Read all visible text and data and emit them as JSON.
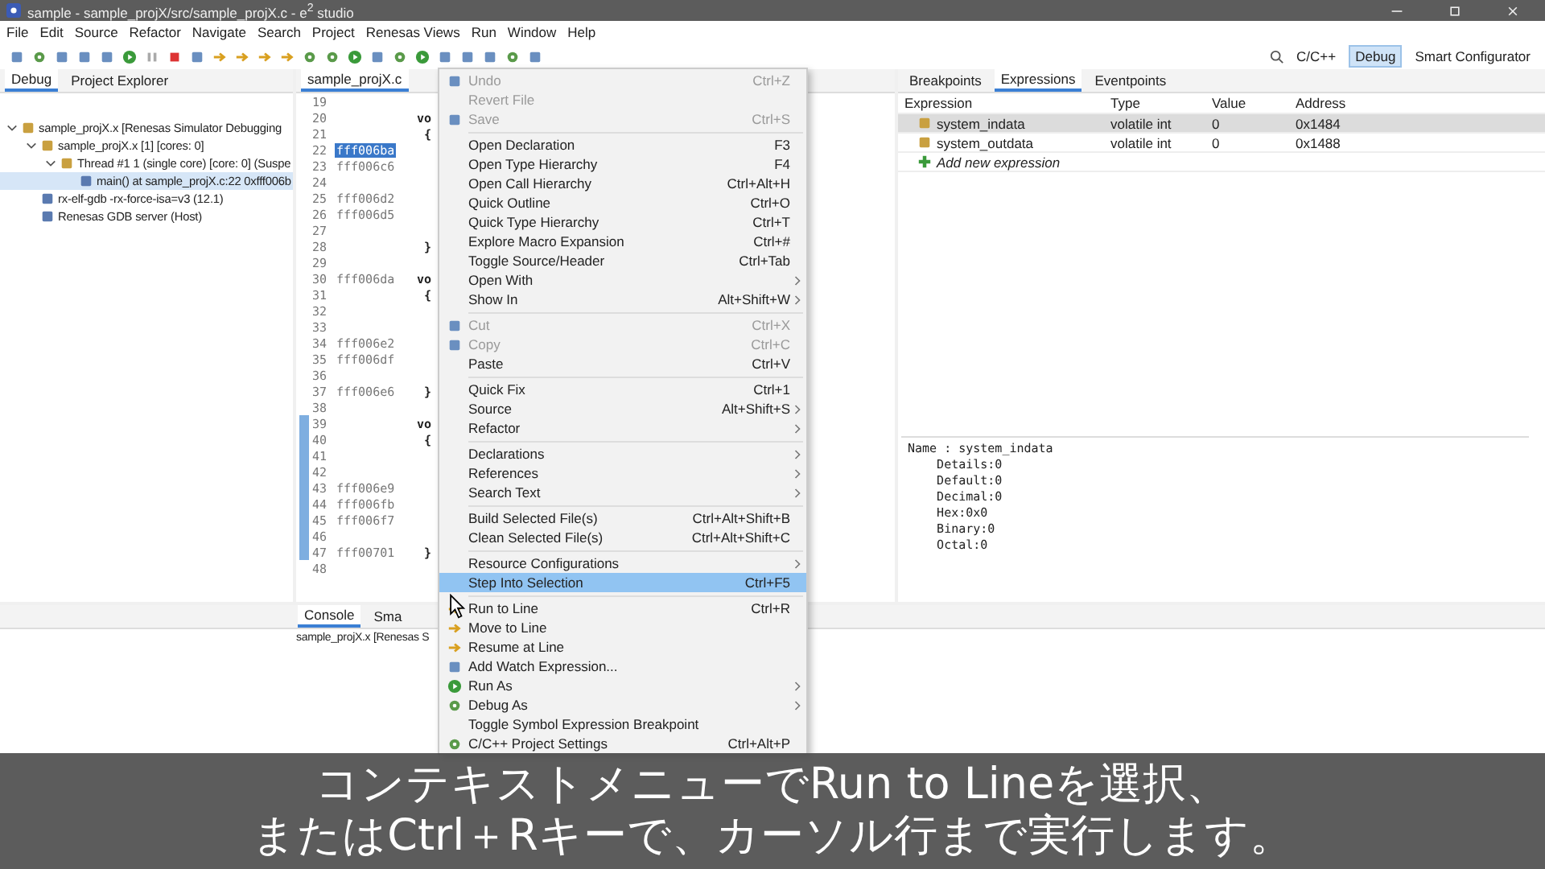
{
  "window": {
    "title": "sample - sample_projX/src/sample_projX.c - e$^{2}$ studio"
  },
  "menu_bar": [
    "File",
    "Edit",
    "Source",
    "Refactor",
    "Navigate",
    "Search",
    "Project",
    "Renesas Views",
    "Run",
    "Window",
    "Help"
  ],
  "perspectives": [
    {
      "label": "C/C++",
      "selected": false
    },
    {
      "label": "Debug",
      "selected": true
    },
    {
      "label": "Smart Configurator",
      "selected": false
    }
  ],
  "debug_panel": {
    "tabs": [
      {
        "label": "Debug",
        "selected": true
      },
      {
        "label": "Project Explorer",
        "selected": false
      }
    ],
    "tree": [
      {
        "label": "sample_projX.x [Renesas Simulator Debugging",
        "expanded": true,
        "selected": false,
        "children": [
          {
            "label": "sample_projX.x [1] [cores: 0]",
            "expanded": true,
            "selected": false,
            "children": [
              {
                "label": "Thread #1 1 (single core) [core: 0] (Suspe",
                "expanded": true,
                "selected": false,
                "children": [
                  {
                    "label": "main() at sample_projX.c:22 0xfff006b",
                    "selected": true
                  }
                ]
              }
            ]
          },
          {
            "label": "rx-elf-gdb -rx-force-isa=v3 (12.1)",
            "selected": false
          },
          {
            "label": "Renesas GDB server (Host)",
            "selected": false
          }
        ]
      }
    ]
  },
  "editor": {
    "tab": "sample_projX.c",
    "lines": [
      {
        "number": "19",
        "marked": false
      },
      {
        "number": "20",
        "code": "vo",
        "marked": false
      },
      {
        "number": "21",
        "code": "{",
        "marked": false
      },
      {
        "number": "22",
        "address": "fff006ba",
        "marked": false,
        "current": true
      },
      {
        "number": "23",
        "address": "fff006c6",
        "marked": false
      },
      {
        "number": "24",
        "marked": false
      },
      {
        "number": "25",
        "address": "fff006d2",
        "marked": false
      },
      {
        "number": "26",
        "address": "fff006d5",
        "marked": false
      },
      {
        "number": "27",
        "marked": false
      },
      {
        "number": "28",
        "code": "}",
        "marked": false
      },
      {
        "number": "29",
        "marked": false
      },
      {
        "number": "30",
        "address": "fff006da",
        "code": "vo",
        "marked": false
      },
      {
        "number": "31",
        "code": "{",
        "marked": false
      },
      {
        "number": "32",
        "marked": false
      },
      {
        "number": "33",
        "marked": false
      },
      {
        "number": "34",
        "address": "fff006e2",
        "marked": false
      },
      {
        "number": "35",
        "address": "fff006df",
        "marked": false
      },
      {
        "number": "36",
        "marked": false
      },
      {
        "number": "37",
        "address": "fff006e6",
        "code": "}",
        "marked": false
      },
      {
        "number": "38",
        "marked": false
      },
      {
        "number": "39",
        "code": "vo",
        "marked": true
      },
      {
        "number": "40",
        "code": "{",
        "marked": true
      },
      {
        "number": "41",
        "marked": true
      },
      {
        "number": "42",
        "marked": true
      },
      {
        "number": "43",
        "address": "fff006e9",
        "marked": true
      },
      {
        "number": "44",
        "address": "fff006fb",
        "marked": true
      },
      {
        "number": "45",
        "address": "fff006f7",
        "marked": true
      },
      {
        "number": "46",
        "marked": true
      },
      {
        "number": "47",
        "address": "fff00701",
        "code": "}",
        "marked": true
      },
      {
        "number": "48",
        "marked": false
      }
    ]
  },
  "context_menu": [
    {
      "kind": "item",
      "label": "Undo",
      "shortcut": "Ctrl+Z",
      "disabled": true,
      "submenu": false,
      "selected": false
    },
    {
      "kind": "item",
      "label": "Revert File",
      "disabled": true,
      "submenu": false,
      "selected": false
    },
    {
      "kind": "item",
      "label": "Save",
      "shortcut": "Ctrl+S",
      "disabled": true,
      "submenu": false,
      "selected": false
    },
    {
      "kind": "separator"
    },
    {
      "kind": "item",
      "label": "Open Declaration",
      "shortcut": "F3",
      "disabled": false,
      "submenu": false,
      "selected": false
    },
    {
      "kind": "item",
      "label": "Open Type Hierarchy",
      "shortcut": "F4",
      "disabled": false,
      "submenu": false,
      "selected": false
    },
    {
      "kind": "item",
      "label": "Open Call Hierarchy",
      "shortcut": "Ctrl+Alt+H",
      "disabled": false,
      "submenu": false,
      "selected": false
    },
    {
      "kind": "item",
      "label": "Quick Outline",
      "shortcut": "Ctrl+O",
      "disabled": false,
      "submenu": false,
      "selected": false
    },
    {
      "kind": "item",
      "label": "Quick Type Hierarchy",
      "shortcut": "Ctrl+T",
      "disabled": false,
      "submenu": false,
      "selected": false
    },
    {
      "kind": "item",
      "label": "Explore Macro Expansion",
      "shortcut": "Ctrl+#",
      "disabled": false,
      "submenu": false,
      "selected": false
    },
    {
      "kind": "item",
      "label": "Toggle Source/Header",
      "shortcut": "Ctrl+Tab",
      "disabled": false,
      "submenu": false,
      "selected": false
    },
    {
      "kind": "item",
      "label": "Open With",
      "disabled": false,
      "submenu": true,
      "selected": false
    },
    {
      "kind": "item",
      "label": "Show In",
      "shortcut": "Alt+Shift+W",
      "disabled": false,
      "submenu": true,
      "selected": false
    },
    {
      "kind": "separator"
    },
    {
      "kind": "item",
      "label": "Cut",
      "shortcut": "Ctrl+X",
      "disabled": true,
      "submenu": false,
      "selected": false
    },
    {
      "kind": "item",
      "label": "Copy",
      "shortcut": "Ctrl+C",
      "disabled": true,
      "submenu": false,
      "selected": false
    },
    {
      "kind": "item",
      "label": "Paste",
      "shortcut": "Ctrl+V",
      "disabled": false,
      "submenu": false,
      "selected": false
    },
    {
      "kind": "separator"
    },
    {
      "kind": "item",
      "label": "Quick Fix",
      "shortcut": "Ctrl+1",
      "disabled": false,
      "submenu": false,
      "selected": false
    },
    {
      "kind": "item",
      "label": "Source",
      "shortcut": "Alt+Shift+S",
      "disabled": false,
      "submenu": true,
      "selected": false
    },
    {
      "kind": "item",
      "label": "Refactor",
      "disabled": false,
      "submenu": true,
      "selected": false
    },
    {
      "kind": "separator"
    },
    {
      "kind": "item",
      "label": "Declarations",
      "disabled": false,
      "submenu": true,
      "selected": false
    },
    {
      "kind": "item",
      "label": "References",
      "disabled": false,
      "submenu": true,
      "selected": false
    },
    {
      "kind": "item",
      "label": "Search Text",
      "disabled": false,
      "submenu": true,
      "selected": false
    },
    {
      "kind": "separator"
    },
    {
      "kind": "item",
      "label": "Build Selected File(s)",
      "shortcut": "Ctrl+Alt+Shift+B",
      "disabled": false,
      "submenu": false,
      "selected": false
    },
    {
      "kind": "item",
      "label": "Clean Selected File(s)",
      "shortcut": "Ctrl+Alt+Shift+C",
      "disabled": false,
      "submenu": false,
      "selected": false
    },
    {
      "kind": "separator"
    },
    {
      "kind": "item",
      "label": "Resource Configurations",
      "disabled": false,
      "submenu": true,
      "selected": false
    },
    {
      "kind": "item",
      "label": "Step Into Selection",
      "shortcut": "Ctrl+F5",
      "disabled": false,
      "submenu": false,
      "selected": true
    },
    {
      "kind": "separator"
    },
    {
      "kind": "item",
      "label": "Run to Line",
      "shortcut": "Ctrl+R",
      "disabled": false,
      "submenu": false,
      "selected": false
    },
    {
      "kind": "item",
      "label": "Move to Line",
      "disabled": false,
      "submenu": false,
      "selected": false
    },
    {
      "kind": "item",
      "label": "Resume at Line",
      "disabled": false,
      "submenu": false,
      "selected": false
    },
    {
      "kind": "item",
      "label": "Add Watch Expression...",
      "disabled": false,
      "submenu": false,
      "selected": false
    },
    {
      "kind": "item",
      "label": "Run As",
      "disabled": false,
      "submenu": true,
      "selected": false
    },
    {
      "kind": "item",
      "label": "Debug As",
      "disabled": false,
      "submenu": true,
      "selected": false
    },
    {
      "kind": "item",
      "label": "Toggle Symbol Expression Breakpoint",
      "disabled": false,
      "submenu": false,
      "selected": false
    },
    {
      "kind": "item",
      "label": "C/C++ Project Settings",
      "shortcut": "Ctrl+Alt+P",
      "disabled": false,
      "submenu": false,
      "selected": false
    }
  ],
  "expressions_panel": {
    "tabs": [
      {
        "label": "Breakpoints",
        "selected": false
      },
      {
        "label": "Expressions",
        "selected": true
      },
      {
        "label": "Eventpoints",
        "selected": false
      }
    ],
    "columns": [
      "Expression",
      "Type",
      "Value",
      "Address"
    ],
    "rows": [
      {
        "expression": "system_indata",
        "type": "volatile int",
        "value": "0",
        "address": "0x1484",
        "selected": true
      },
      {
        "expression": "system_outdata",
        "type": "volatile int",
        "value": "0",
        "address": "0x1488",
        "selected": false
      }
    ],
    "add_row": "Add new expression",
    "details": [
      "Name : system_indata",
      "    Details:0",
      "    Default:0",
      "    Decimal:0",
      "    Hex:0x0",
      "    Binary:0",
      "    Octal:0"
    ]
  },
  "console_panel": {
    "tabs": [
      {
        "label": "Console",
        "selected": true
      },
      {
        "label": "Sma",
        "selected": false
      }
    ],
    "text": "sample_projX.x [Renesas S"
  },
  "subtitle": [
    "コンテキストメニューでRun to Lineを選択、",
    "またはCtrl＋Rキーで、カーソル行まで実行します。"
  ]
}
